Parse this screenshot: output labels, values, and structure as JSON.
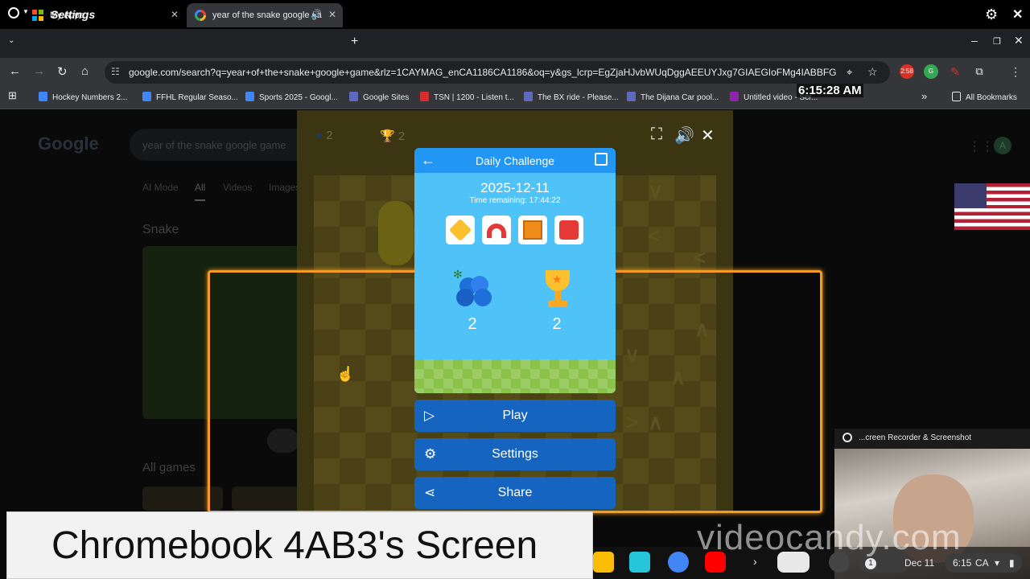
{
  "window": {
    "title": "Settings"
  },
  "tabs": [
    {
      "label": "My Apps"
    },
    {
      "label": "year of the snake google ga"
    }
  ],
  "toolbar": {
    "url": "google.com/search?q=year+of+the+snake+google+game&rlz=1CAYMAG_enCA1186CA1186&oq=y&gs_lcrp=EgZjaHJvbWUqDggAEEUYJxg7GIAEGIoFMg4IABBFGCcYOx...",
    "ext_badge": "2:58"
  },
  "bookmarks": [
    {
      "label": "Hockey Numbers 2...",
      "color": "#4285f4"
    },
    {
      "label": "FFHL Regular Seaso...",
      "color": "#4285f4"
    },
    {
      "label": "Sports 2025 - Googl...",
      "color": "#4285f4"
    },
    {
      "label": "Google Sites",
      "color": "#5c6bc0"
    },
    {
      "label": "TSN | 1200 - Listen t...",
      "color": "#d32f2f"
    },
    {
      "label": "The BX ride - Please...",
      "color": "#5c6bc0"
    },
    {
      "label": "The Dijana Car pool...",
      "color": "#5c6bc0"
    },
    {
      "label": "Untitled video - Scr...",
      "color": "#8e24aa"
    }
  ],
  "all_bookmarks": "All Bookmarks",
  "overlay_time": "6:15:28 AM",
  "search_page": {
    "logo": "Google",
    "query": "year of the snake google game",
    "filters": [
      "AI Mode",
      "All",
      "Videos",
      "Images"
    ],
    "section": "Snake",
    "all_games": "All games"
  },
  "game": {
    "berries": "2",
    "trophies": "2",
    "dialog": {
      "title": "Daily Challenge",
      "date": "2025-12-11",
      "time_remaining": "Time remaining: 17:44:22",
      "berry_count": "2",
      "trophy_count": "2"
    },
    "buttons": {
      "play": "Play",
      "settings": "Settings",
      "share": "Share"
    }
  },
  "recorder": {
    "title": "...creen Recorder & Screenshot"
  },
  "shelf": {
    "date": "Dec 11",
    "time": "6:15",
    "region": "CA",
    "notif_count": "1"
  },
  "watermark": "videocandy.com",
  "caption": "Chromebook 4AB3's Screen"
}
